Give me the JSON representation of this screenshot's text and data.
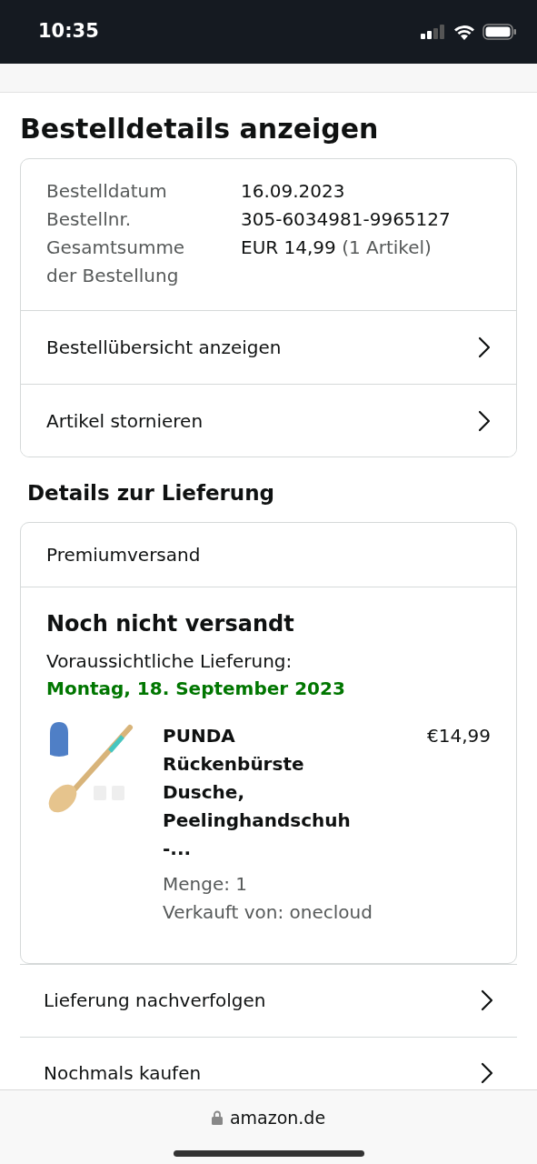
{
  "status_bar": {
    "time": "10:35"
  },
  "page_title": "Bestelldetails anzeigen",
  "order_summary": {
    "fields": [
      {
        "label": "Bestelldatum",
        "value": "16.09.2023"
      },
      {
        "label": "Bestellnr.",
        "value": "305-6034981-9965127"
      },
      {
        "label": "Gesamtsumme der Bestellung",
        "value": "EUR 14,99",
        "note": "(1 Artikel)"
      }
    ],
    "links": [
      "Bestellübersicht anzeigen",
      "Artikel stornieren"
    ]
  },
  "delivery": {
    "heading": "Details zur Lieferung",
    "shipping_method": "Premiumversand",
    "status": "Noch nicht versandt",
    "expected_label": "Voraussichtliche Lieferung:",
    "expected_date": "Montag, 18. September 2023",
    "item": {
      "kind": "picture",
      "title": "PUNDA Rückenbürste Dusche, Peelinghandschuh -...",
      "quantity": "Menge: 1",
      "seller": "Verkauft von: onecloud",
      "price": "€14,99"
    }
  },
  "actions": [
    "Lieferung nachverfolgen",
    "Nochmals kaufen"
  ],
  "browser_bar": {
    "url": "amazon.de"
  }
}
